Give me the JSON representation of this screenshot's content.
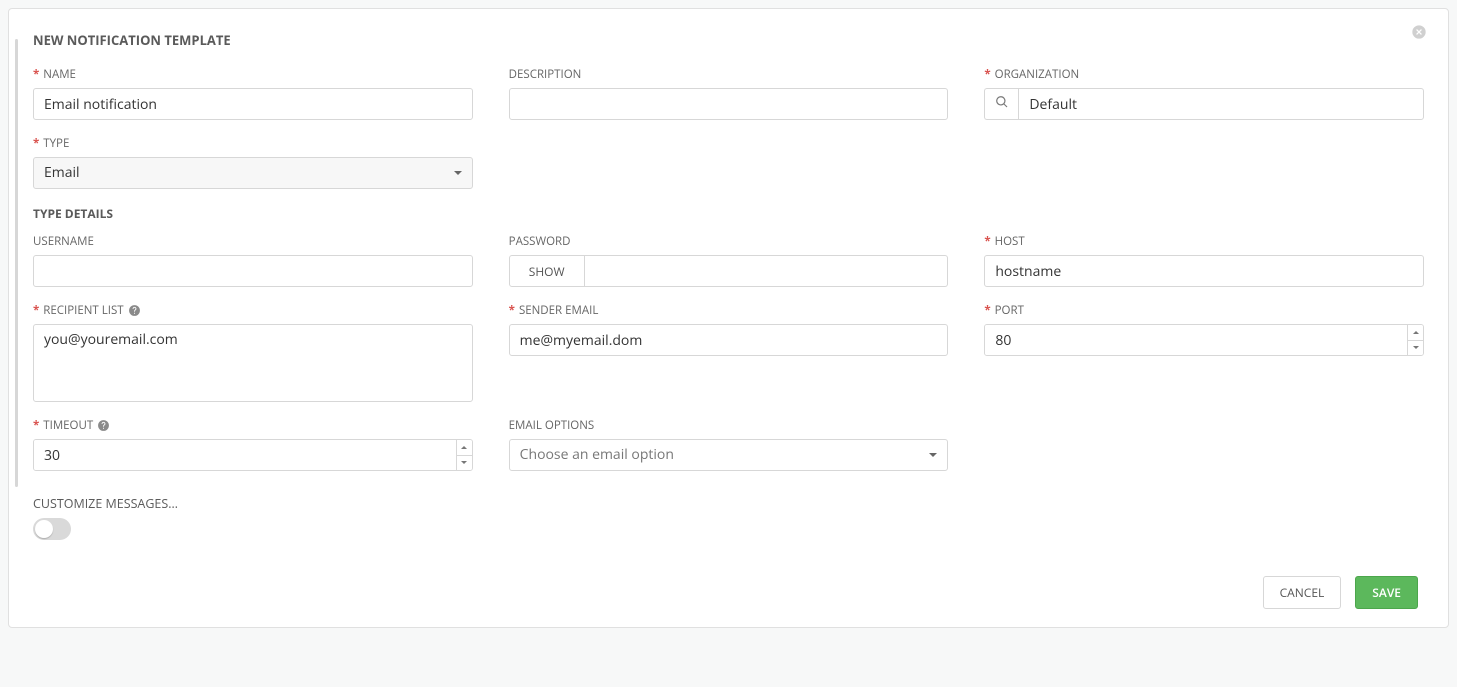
{
  "panel": {
    "title": "NEW NOTIFICATION TEMPLATE"
  },
  "fields": {
    "name": {
      "label": "NAME",
      "value": "Email notification"
    },
    "description": {
      "label": "DESCRIPTION",
      "value": ""
    },
    "organization": {
      "label": "ORGANIZATION",
      "value": "Default"
    },
    "type": {
      "label": "TYPE",
      "value": "Email"
    },
    "type_details_header": "TYPE DETAILS",
    "username": {
      "label": "USERNAME",
      "value": ""
    },
    "password": {
      "label": "PASSWORD",
      "show_btn": "SHOW",
      "value": ""
    },
    "host": {
      "label": "HOST",
      "value": "hostname"
    },
    "recipient_list": {
      "label": "RECIPIENT LIST",
      "value": "you@youremail.com"
    },
    "sender_email": {
      "label": "SENDER EMAIL",
      "value": "me@myemail.dom"
    },
    "port": {
      "label": "PORT",
      "value": "80"
    },
    "timeout": {
      "label": "TIMEOUT",
      "value": "30"
    },
    "email_options": {
      "label": "EMAIL OPTIONS",
      "placeholder": "Choose an email option"
    },
    "customize_messages": {
      "label": "CUSTOMIZE MESSAGES…"
    }
  },
  "footer": {
    "cancel": "CANCEL",
    "save": "SAVE"
  }
}
